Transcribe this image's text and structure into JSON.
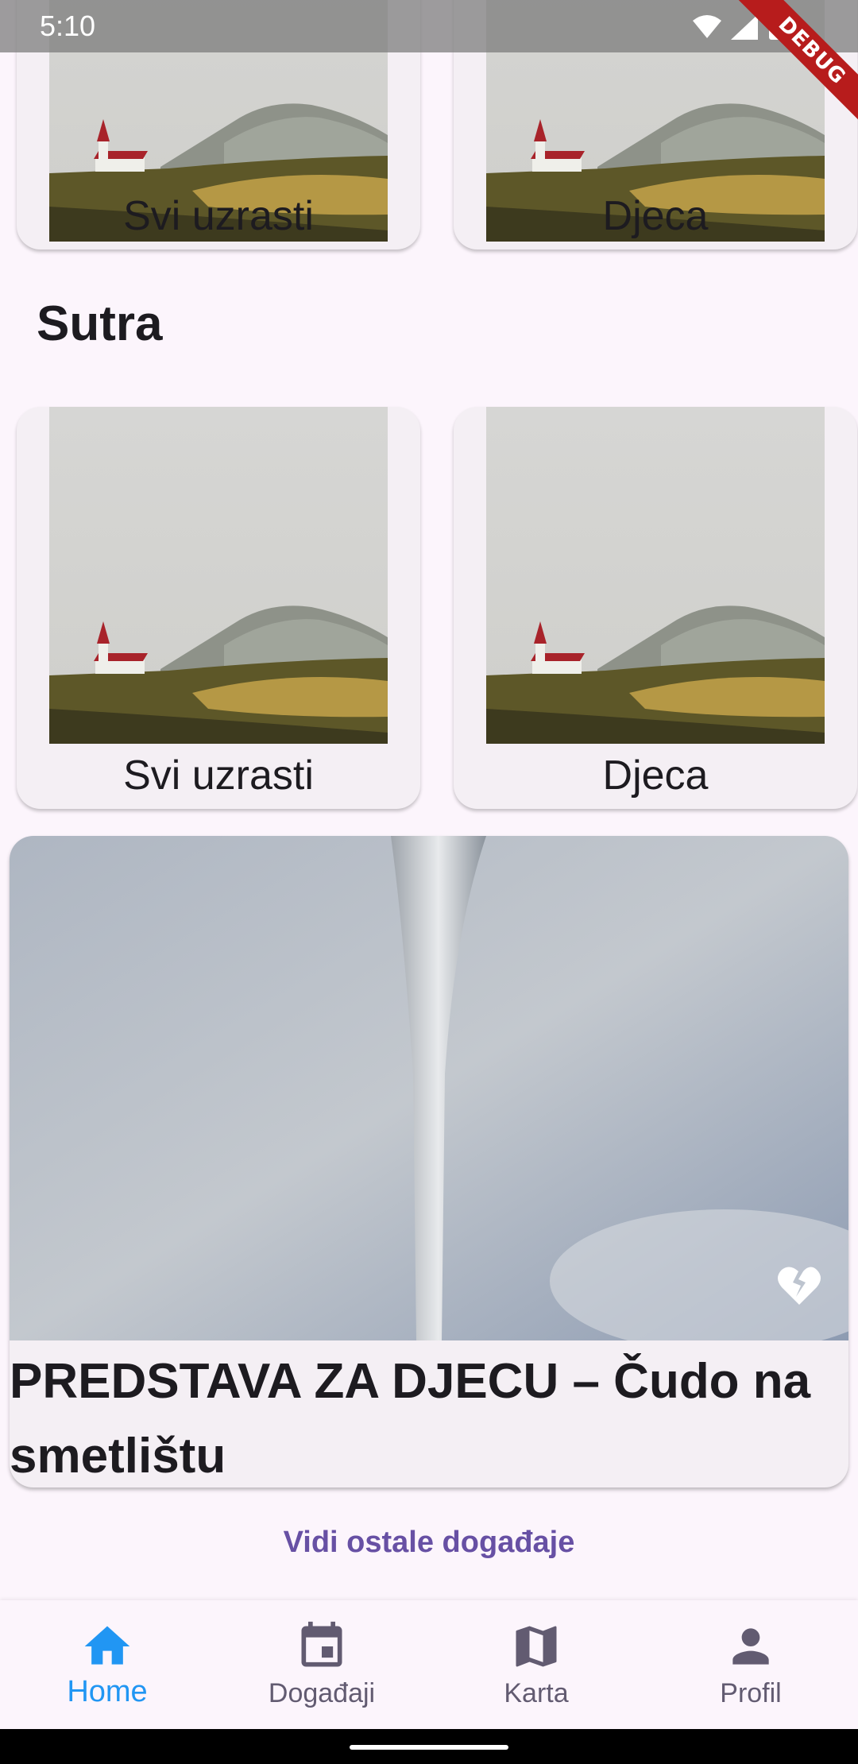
{
  "status_bar": {
    "time": "5:10",
    "debug_banner": "DEBUG"
  },
  "top_cards": [
    {
      "label": "Svi uzrasti"
    },
    {
      "label": "Djeca"
    }
  ],
  "section": {
    "title": "Sutra"
  },
  "tomorrow_cards": [
    {
      "label": "Svi uzrasti"
    },
    {
      "label": "Djeca"
    }
  ],
  "event": {
    "title": "PREDSTAVA ZA DJECU – Čudo na smetlištu",
    "favorite_icon": "broken-heart-icon"
  },
  "more_link": "Vidi ostale događaje",
  "bottom_nav": {
    "items": [
      {
        "label": "Home",
        "icon": "home-icon",
        "active": true
      },
      {
        "label": "Događaji",
        "icon": "calendar-icon",
        "active": false
      },
      {
        "label": "Karta",
        "icon": "map-icon",
        "active": false
      },
      {
        "label": "Profil",
        "icon": "person-icon",
        "active": false
      }
    ]
  },
  "colors": {
    "background": "#fcf5fc",
    "card": "#f4eff4",
    "accent_active": "#2196f3",
    "link": "#6750a4",
    "nav_inactive": "#625b71"
  }
}
